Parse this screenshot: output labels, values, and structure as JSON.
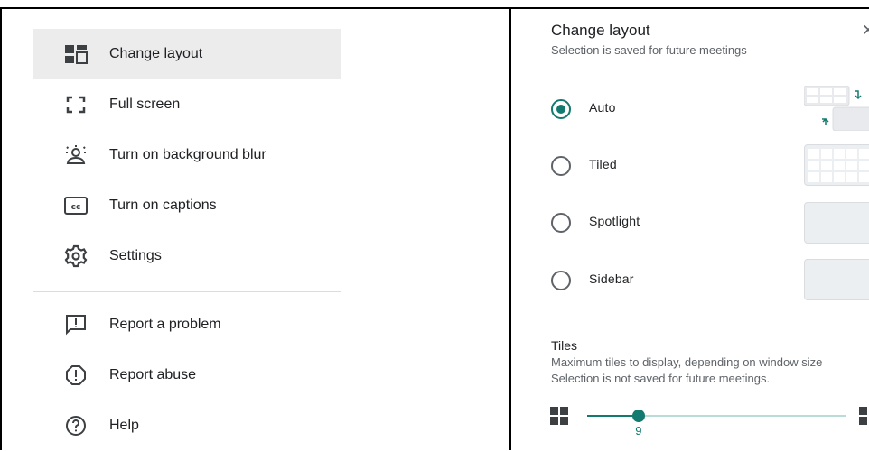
{
  "menu": {
    "items": [
      {
        "label": "Change layout",
        "icon": "layout-icon",
        "active": true
      },
      {
        "label": "Full screen",
        "icon": "fullscreen-icon"
      },
      {
        "label": "Turn on background blur",
        "icon": "background-blur-icon"
      },
      {
        "label": "Turn on captions",
        "icon": "captions-icon"
      },
      {
        "label": "Settings",
        "icon": "gear-icon"
      },
      {
        "label": "Report a problem",
        "icon": "feedback-icon"
      },
      {
        "label": "Report abuse",
        "icon": "report-abuse-icon"
      },
      {
        "label": "Help",
        "icon": "help-icon"
      }
    ]
  },
  "panel": {
    "title": "Change layout",
    "subtitle": "Selection is saved for future meetings",
    "close_icon": "close-icon",
    "options": [
      {
        "label": "Auto",
        "selected": true
      },
      {
        "label": "Tiled",
        "selected": false
      },
      {
        "label": "Spotlight",
        "selected": false
      },
      {
        "label": "Sidebar",
        "selected": false
      }
    ],
    "tiles": {
      "heading": "Tiles",
      "desc_line1": "Maximum tiles to display, depending on window size",
      "desc_line2": "Selection is not saved for future meetings.",
      "value": "9",
      "value_fraction": 0.2
    }
  },
  "colors": {
    "accent": "#137a6f",
    "active_bg": "#ececec"
  }
}
